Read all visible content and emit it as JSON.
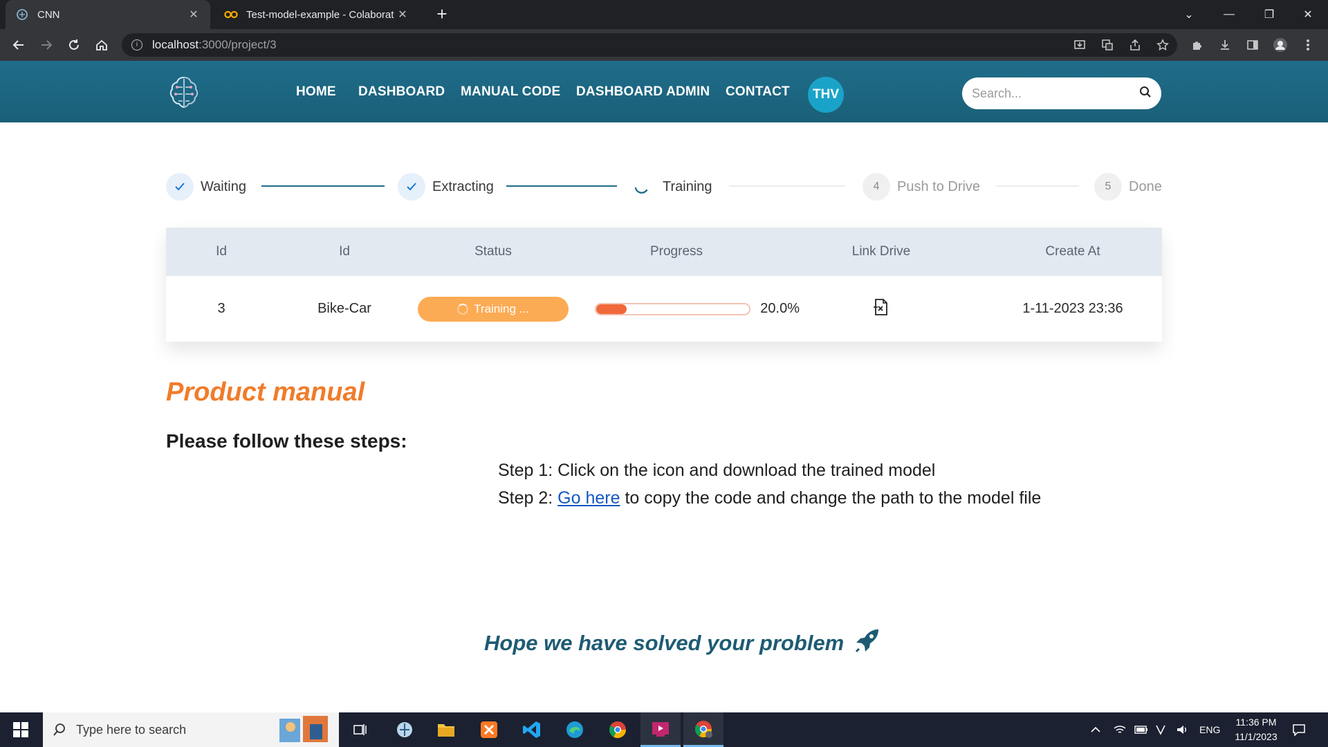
{
  "browser": {
    "tabs": [
      {
        "title": "CNN",
        "active": true
      },
      {
        "title": "Test-model-example - Colaborat",
        "active": false
      }
    ],
    "url_host": "localhost",
    "url_path": ":3000/project/3"
  },
  "header": {
    "nav": [
      "HOME",
      "DASHBOARD",
      "MANUAL CODE",
      "DASHBOARD ADMIN",
      "CONTACT"
    ],
    "avatar": "THV",
    "search_placeholder": "Search..."
  },
  "stepper": {
    "steps": [
      {
        "label": "Waiting",
        "state": "done",
        "marker": ""
      },
      {
        "label": "Extracting",
        "state": "done",
        "marker": ""
      },
      {
        "label": "Training",
        "state": "active",
        "marker": ""
      },
      {
        "label": "Push to Drive",
        "state": "todo",
        "marker": "4"
      },
      {
        "label": "Done",
        "state": "todo",
        "marker": "5"
      }
    ]
  },
  "table": {
    "headers": [
      "Id",
      "Id",
      "Status",
      "Progress",
      "Link Drive",
      "Create At"
    ],
    "row": {
      "id": "3",
      "name": "Bike-Car",
      "status": "Training ...",
      "progress": 0.2,
      "progress_text": "20.0%",
      "link_icon": "file-export-icon",
      "created": "1-11-2023 23:36"
    }
  },
  "manual": {
    "title": "Product manual",
    "subtitle": "Please follow these steps:",
    "step1": "Step 1: Click on the icon and download the trained model",
    "step2_prefix": "Step 2: ",
    "step2_link": "Go here",
    "step2_suffix": " to copy the code and change the path to the model file",
    "footer": "Hope we have solved your problem"
  },
  "taskbar": {
    "search_placeholder": "Type here to search",
    "lang": "ENG",
    "time": "11:36 PM",
    "date": "11/1/2023"
  },
  "colors": {
    "header": "#1f6d8a",
    "accent_orange": "#f07c2a",
    "status_pill": "#fcab55",
    "progress_fill": "#f1693a",
    "step_done": "#1976d2"
  }
}
